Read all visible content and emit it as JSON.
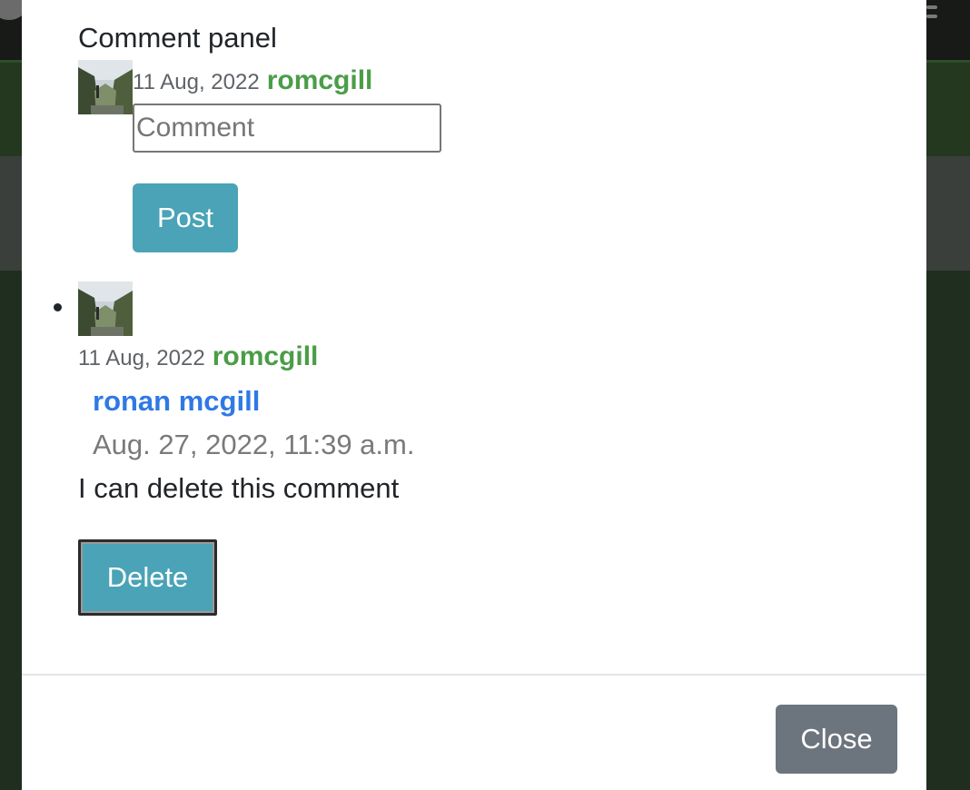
{
  "modal": {
    "panel_title": "Comment panel",
    "form": {
      "date": "11 Aug, 2022",
      "username": "romcgill",
      "comment_placeholder": "Comment",
      "comment_value": "",
      "post_label": "Post"
    },
    "comments": [
      {
        "date": "11 Aug, 2022",
        "username": "romcgill",
        "author": "ronan mcgill",
        "timestamp": "Aug. 27, 2022, 11:39 a.m.",
        "text": "I can delete this comment",
        "delete_label": "Delete"
      }
    ],
    "footer": {
      "close_label": "Close"
    }
  },
  "colors": {
    "accent_button": "#4aa3b6",
    "username": "#4a9d47",
    "author_link": "#2f79e5",
    "close_button": "#6c757d"
  }
}
